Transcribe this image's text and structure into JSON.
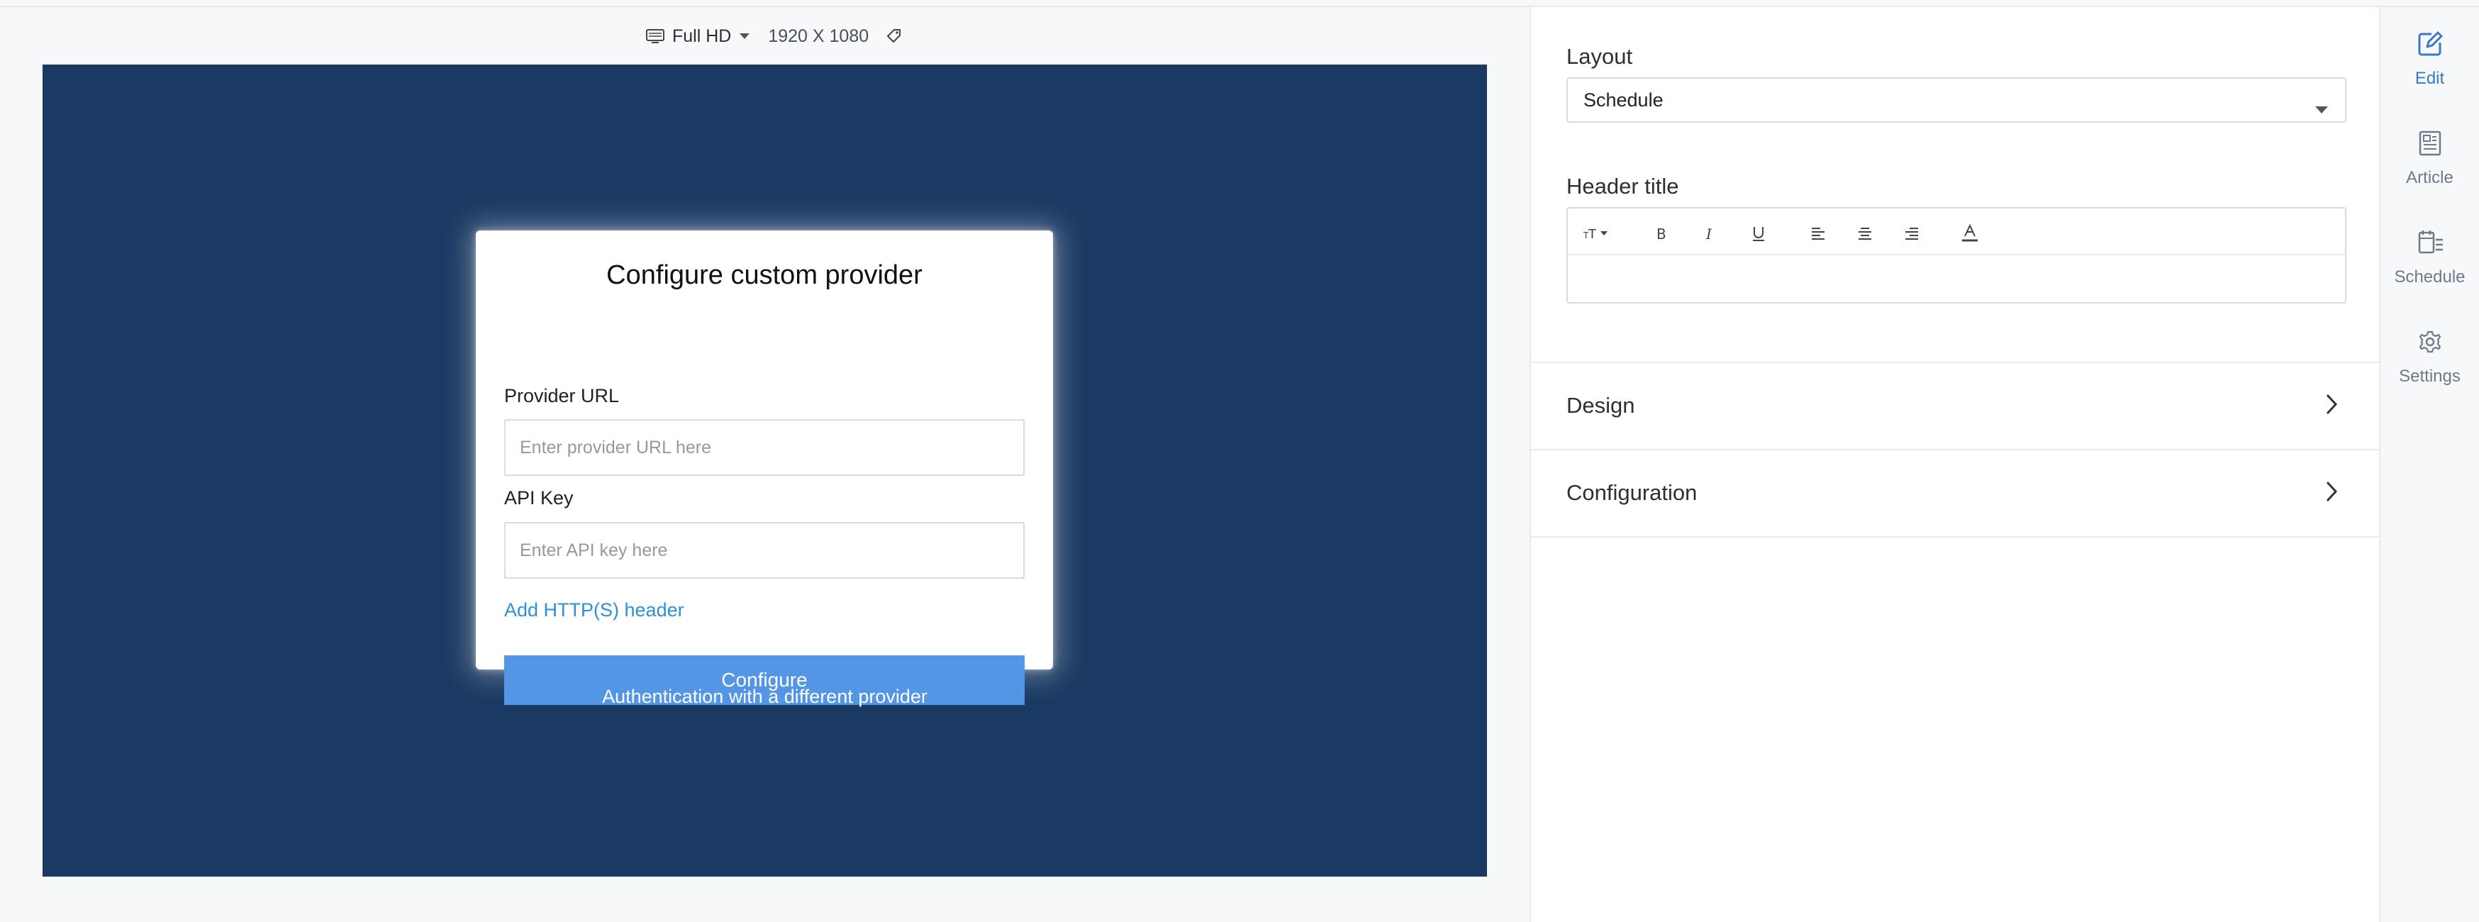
{
  "preview_toolbar": {
    "resolution_label": "Full HD",
    "resolution_dims": "1920 X 1080",
    "monitor_icon": "monitor-icon",
    "caret_icon": "caret-down-icon",
    "tag_icon": "tag-icon"
  },
  "modal": {
    "title": "Configure custom provider",
    "provider_url_label": "Provider URL",
    "provider_url_placeholder": "Enter provider URL here",
    "api_key_label": "API Key",
    "api_key_placeholder": "Enter API key here",
    "add_header_link": "Add HTTP(S) header",
    "configure_button": "Configure"
  },
  "auth_link": "Authentication with a different provider",
  "panel": {
    "layout_label": "Layout",
    "layout_value": "Schedule",
    "header_title_label": "Header title",
    "editor_toolbar": [
      "font-size-icon",
      "bold-icon",
      "italic-icon",
      "underline-icon",
      "align-left-icon",
      "align-center-icon",
      "align-right-icon",
      "text-color-icon"
    ],
    "sections": [
      {
        "label": "Design"
      },
      {
        "label": "Configuration"
      }
    ]
  },
  "rail": {
    "items": [
      {
        "label": "Edit",
        "icon": "edit-icon",
        "active": true
      },
      {
        "label": "Article",
        "icon": "article-icon",
        "active": false
      },
      {
        "label": "Schedule",
        "icon": "schedule-icon",
        "active": false
      },
      {
        "label": "Settings",
        "icon": "gear-icon",
        "active": false
      }
    ]
  },
  "colors": {
    "canvas_bg": "#1b3a63",
    "primary_button": "#5296e5",
    "link": "#2f8fd6",
    "rail_active": "#3a79c9"
  }
}
